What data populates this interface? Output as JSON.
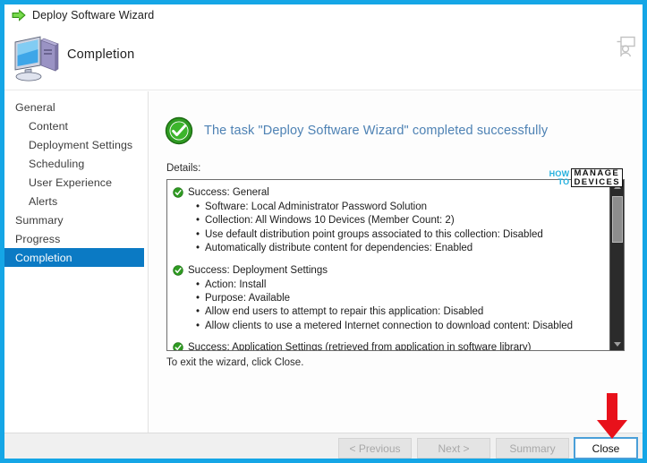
{
  "window": {
    "title": "Deploy Software Wizard",
    "title_icon": "green-right-arrow-icon"
  },
  "header": {
    "page_title": "Completion",
    "page_icon": "computer-monitor-icon",
    "help_icon": "help-person-board-icon"
  },
  "sidebar": {
    "items": [
      {
        "label": "General",
        "indent": false,
        "selected": false
      },
      {
        "label": "Content",
        "indent": true,
        "selected": false
      },
      {
        "label": "Deployment Settings",
        "indent": true,
        "selected": false
      },
      {
        "label": "Scheduling",
        "indent": true,
        "selected": false
      },
      {
        "label": "User Experience",
        "indent": true,
        "selected": false
      },
      {
        "label": "Alerts",
        "indent": true,
        "selected": false
      },
      {
        "label": "Summary",
        "indent": false,
        "selected": false
      },
      {
        "label": "Progress",
        "indent": false,
        "selected": false
      },
      {
        "label": "Completion",
        "indent": false,
        "selected": true
      }
    ],
    "selected_bg": "#0b7ac4"
  },
  "main": {
    "success_heading": "The task \"Deploy Software Wizard\" completed successfully",
    "success_heading_color": "#4e82b4",
    "success_icon": "green-check-circle-icon",
    "details_label": "Details:",
    "exit_note": "To exit the wizard, click Close.",
    "detail_groups": [
      {
        "status_icon": "green-check-small-icon",
        "heading": "Success: General",
        "bullets": [
          "Software: Local Administrator Password Solution",
          "Collection: All Windows 10 Devices (Member Count: 2)",
          "Use default distribution point groups associated to this collection: Disabled",
          "Automatically distribute content for dependencies: Enabled"
        ]
      },
      {
        "status_icon": "green-check-small-icon",
        "heading": "Success: Deployment Settings",
        "bullets": [
          "Action: Install",
          "Purpose: Available",
          "Allow end users to attempt to repair this application: Disabled",
          "Allow clients to use a metered Internet connection to download content: Disabled"
        ]
      },
      {
        "status_icon": "green-check-small-icon",
        "heading": "Success: Application Settings (retrieved from application in software library)",
        "bullets": []
      }
    ],
    "scrollbar": {
      "up_icon": "chevron-up-icon",
      "down_icon": "chevron-down-icon",
      "thumb_position_percent": 9
    }
  },
  "watermark": {
    "line1": "HOW",
    "line2": "TO",
    "boxed_line1": "MANAGE",
    "boxed_line2": "DEVICES",
    "accent_color": "#23b0de"
  },
  "annotation": {
    "arrow_icon": "red-down-arrow-icon",
    "arrow_color": "#e8111b",
    "points_to": "close-button"
  },
  "footer": {
    "buttons": [
      {
        "label": "< Previous",
        "enabled": false
      },
      {
        "label": "Next >",
        "enabled": false
      },
      {
        "label": "Summary",
        "enabled": false
      },
      {
        "label": "Close",
        "enabled": true
      }
    ]
  },
  "frame": {
    "border_color": "#15a6e6"
  }
}
